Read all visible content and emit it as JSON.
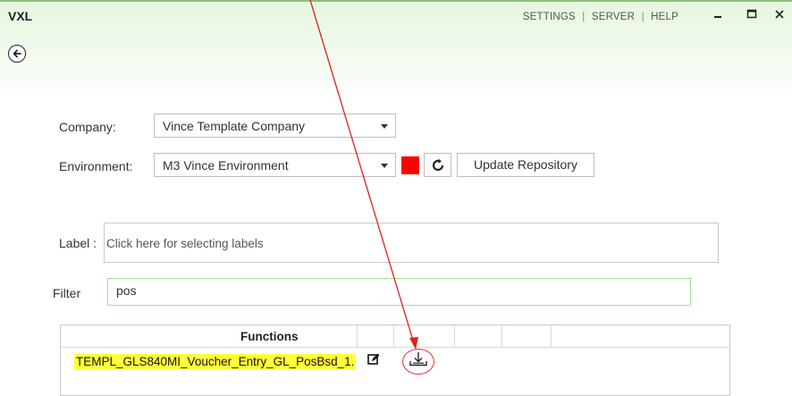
{
  "window": {
    "app_title": "VXL",
    "menu": {
      "settings": "SETTINGS",
      "server": "SERVER",
      "help": "HELP",
      "separator": "|"
    }
  },
  "form": {
    "company": {
      "label": "Company:",
      "value": "Vince Template Company"
    },
    "environment": {
      "label": "Environment:",
      "value": "M3 Vince Environment",
      "status_color": "#ff0000"
    },
    "update_button": "Update Repository",
    "label_field": {
      "label": "Label :",
      "placeholder": "Click here for selecting labels"
    },
    "filter_field": {
      "label": "Filter",
      "value": "pos"
    }
  },
  "functions_grid": {
    "header": "Functions",
    "rows": [
      {
        "name": "TEMPL_GLS840MI_Voucher_Entry_GL_PosBsd_1.",
        "highlight_color": "#ffff3a"
      }
    ]
  },
  "annotations": {
    "arrow_color": "#e02020"
  },
  "icons": [
    "back-arrow-icon",
    "minimize-icon",
    "maximize-icon",
    "close-icon",
    "caret-down-icon",
    "refresh-icon",
    "edit-icon",
    "download-icon"
  ]
}
